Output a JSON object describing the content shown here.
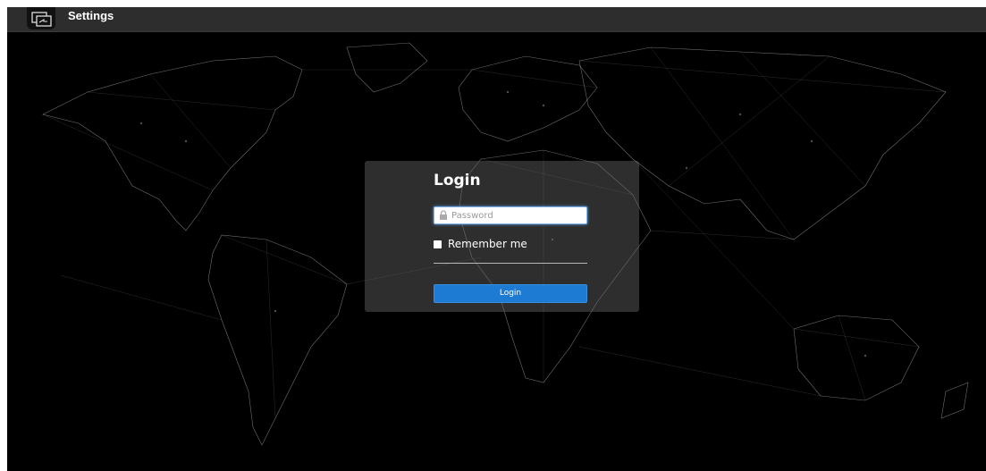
{
  "header": {
    "title": "Settings",
    "app_icon": "screen-share-icon"
  },
  "login": {
    "title": "Login",
    "password_placeholder": "Password",
    "password_value": "",
    "password_icon": "lock-icon",
    "remember_label": "Remember me",
    "remember_checked": false,
    "button_label": "Login"
  },
  "background": {
    "type": "world-network-map",
    "color": "#000000"
  },
  "colors": {
    "topbar": "#2d2d2d",
    "button": "#1d7bd4",
    "field_focus": "#5fa8f0"
  }
}
